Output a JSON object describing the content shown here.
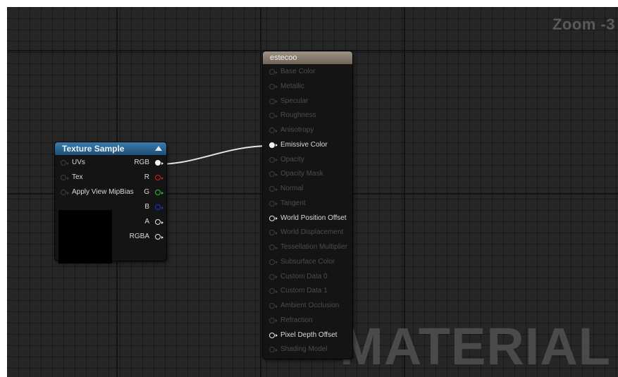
{
  "zoom_label": "Zoom -3",
  "watermark": "MATERIAL",
  "texture_node": {
    "title": "Texture Sample",
    "inputs": [
      {
        "label": "UVs"
      },
      {
        "label": "Tex"
      },
      {
        "label": "Apply View MipBias"
      }
    ],
    "outputs": [
      {
        "label": "RGB",
        "color": "#f2f2f2",
        "connected": true
      },
      {
        "label": "R",
        "color": "#e01b1b"
      },
      {
        "label": "G",
        "color": "#22cc22"
      },
      {
        "label": "B",
        "color": "#2233dd"
      },
      {
        "label": "A",
        "color": "#e8e8e8"
      },
      {
        "label": "RGBA",
        "color": "#e8e8e8"
      }
    ]
  },
  "material_node": {
    "title": "estecoo",
    "inputs": [
      {
        "label": "Base Color",
        "active": false
      },
      {
        "label": "Metallic",
        "active": false
      },
      {
        "label": "Specular",
        "active": false
      },
      {
        "label": "Roughness",
        "active": false
      },
      {
        "label": "Anisotropy",
        "active": false
      },
      {
        "label": "Emissive Color",
        "active": true,
        "connected": true
      },
      {
        "label": "Opacity",
        "active": false
      },
      {
        "label": "Opacity Mask",
        "active": false
      },
      {
        "label": "Normal",
        "active": false
      },
      {
        "label": "Tangent",
        "active": false
      },
      {
        "label": "World Position Offset",
        "active": true
      },
      {
        "label": "World Displacement",
        "active": false
      },
      {
        "label": "Tessellation Multiplier",
        "active": false
      },
      {
        "label": "Subsurface Color",
        "active": false
      },
      {
        "label": "Custom Data 0",
        "active": false
      },
      {
        "label": "Custom Data 1",
        "active": false
      },
      {
        "label": "Ambient Occlusion",
        "active": false
      },
      {
        "label": "Refraction",
        "active": false
      },
      {
        "label": "Pixel Depth Offset",
        "active": true
      },
      {
        "label": "Shading Model",
        "active": false
      }
    ]
  }
}
